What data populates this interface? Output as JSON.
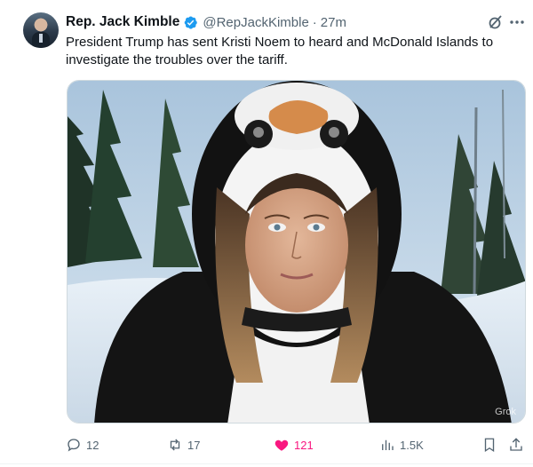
{
  "author": {
    "name": "Rep. Jack Kimble",
    "handle": "@RepJackKimble",
    "separator": "·",
    "time": "27m",
    "verified": true
  },
  "post": {
    "text": "President Trump has sent Kristi Noem to heard and McDonald Islands to investigate the troubles over the tariff."
  },
  "media": {
    "watermark": "Grok"
  },
  "actions": {
    "replies": "12",
    "reposts": "17",
    "likes": "121",
    "views": "1.5K"
  },
  "colors": {
    "text_primary": "#0f1419",
    "text_secondary": "#536471",
    "verified_blue": "#1d9bf0",
    "like_pink": "#f91880",
    "border": "#cfd9de"
  },
  "icons": [
    "verified-badge-icon",
    "grok-icon",
    "more-icon",
    "reply-icon",
    "repost-icon",
    "heart-icon",
    "views-icon",
    "bookmark-icon",
    "share-icon"
  ]
}
